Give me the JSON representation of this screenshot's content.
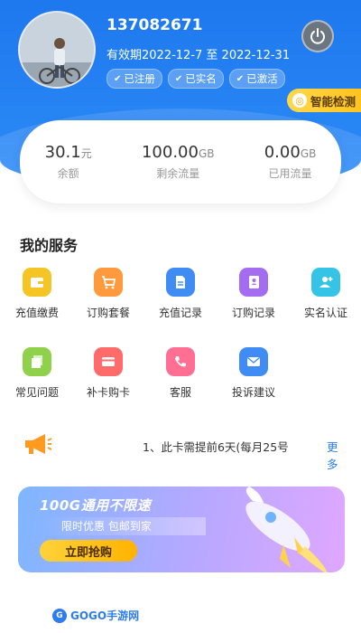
{
  "profile": {
    "phone": "137082671",
    "validity": "有效期2022-12-7 至 2022-12-31",
    "badges": [
      "已注册",
      "已实名",
      "已激活"
    ]
  },
  "smart_check_label": "智能检测",
  "stats": [
    {
      "value": "30.1",
      "unit": "元",
      "label": "余额"
    },
    {
      "value": "100.00",
      "unit": "GB",
      "label": "剩余流量"
    },
    {
      "value": "0.00",
      "unit": "GB",
      "label": "已用流量"
    }
  ],
  "services": {
    "title": "我的服务",
    "items": [
      {
        "label": "充值缴费",
        "icon": "wallet-icon",
        "color": "#f5c526"
      },
      {
        "label": "订购套餐",
        "icon": "cart-icon",
        "color": "#ff9a3c"
      },
      {
        "label": "充值记录",
        "icon": "document-icon",
        "color": "#3f8cf5"
      },
      {
        "label": "订购记录",
        "icon": "notebook-icon",
        "color": "#a46cf0"
      },
      {
        "label": "实名认证",
        "icon": "add-user-icon",
        "color": "#35c3e6"
      },
      {
        "label": "常见问题",
        "icon": "copy-icon",
        "color": "#8fd14a"
      },
      {
        "label": "补卡购卡",
        "icon": "card-icon",
        "color": "#ff6b6b"
      },
      {
        "label": "客服",
        "icon": "phone-icon",
        "color": "#ff6f93"
      },
      {
        "label": "投诉建议",
        "icon": "mail-icon",
        "color": "#3f8cf5"
      }
    ]
  },
  "notice": {
    "text": "1、此卡需提前6天(每月25号",
    "more": "更多"
  },
  "banner": {
    "headline": "100G通用不限速",
    "sub": "限时优惠 包邮到家",
    "button": "立即抢购"
  },
  "watermark": "GOGO手游网"
}
